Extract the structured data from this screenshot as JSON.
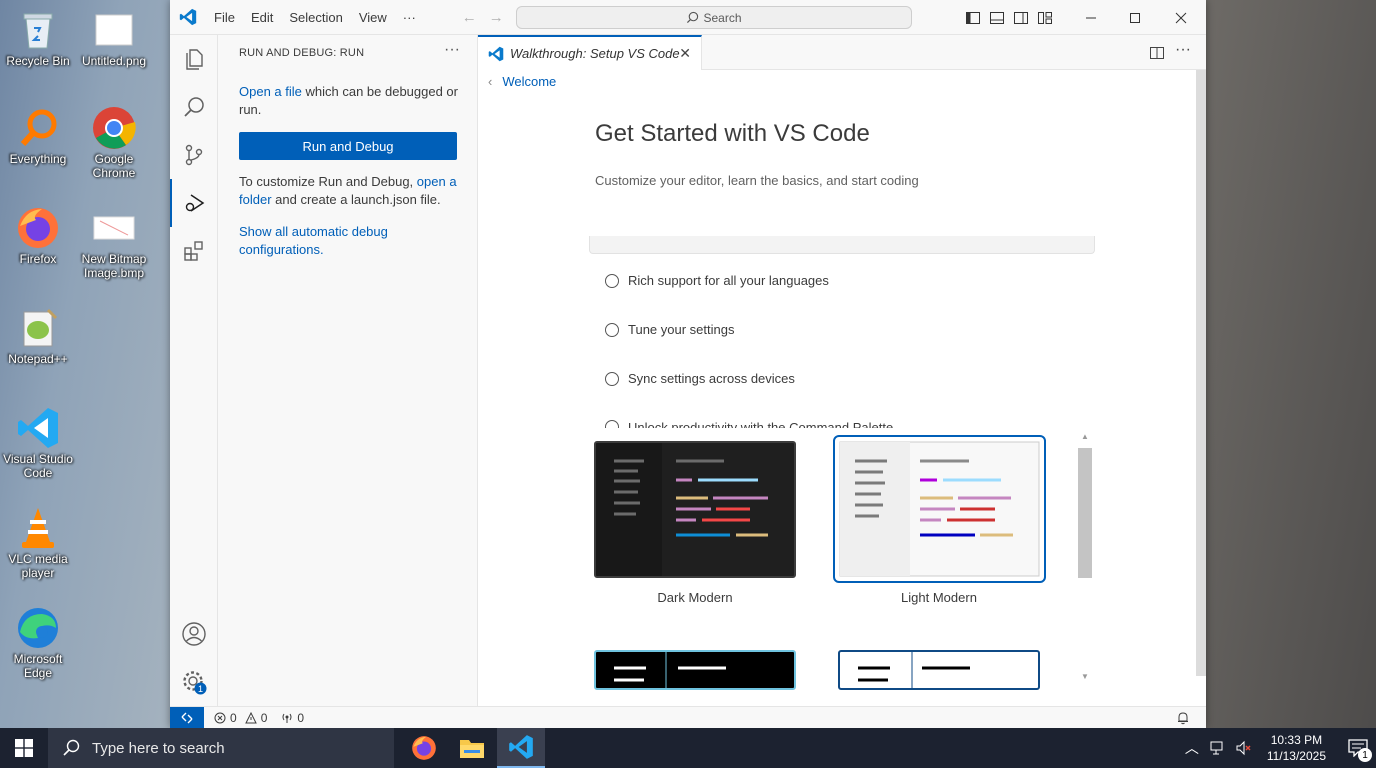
{
  "desktop": {
    "icons": [
      {
        "label": "Recycle Bin"
      },
      {
        "label": "Untitled.png"
      },
      {
        "label": "Everything"
      },
      {
        "label": "Google Chrome"
      },
      {
        "label": "Firefox"
      },
      {
        "label": "New Bitmap Image.bmp"
      },
      {
        "label": "Notepad++"
      },
      {
        "label": "Visual Studio Code"
      },
      {
        "label": "VLC media player"
      },
      {
        "label": "Microsoft Edge"
      }
    ]
  },
  "titlebar": {
    "menu": [
      "File",
      "Edit",
      "Selection",
      "View",
      "···"
    ],
    "search_label": "Search"
  },
  "sidebar": {
    "title": "RUN AND DEBUG: RUN",
    "more": "···",
    "open_file_link": "Open a file",
    "open_file_rest": " which can be debugged or run.",
    "run_button": "Run and Debug",
    "customize_pre": "To customize Run and Debug, ",
    "open_folder_link": "open a folder",
    "customize_post": " and create a launch.json file.",
    "show_all_link": "Show all automatic debug configurations",
    "show_all_end": "."
  },
  "tab": {
    "label": "Walkthrough: Setup VS Code",
    "close": "✕"
  },
  "walkthrough": {
    "breadcrumb": "Welcome",
    "title": "Get Started with VS Code",
    "subtitle": "Customize your editor, learn the basics, and start coding",
    "steps": [
      "Rich support for all your languages",
      "Tune your settings",
      "Sync settings across devices",
      "Unlock productivity with the Command Palette"
    ],
    "themes": [
      "Dark Modern",
      "Light Modern"
    ]
  },
  "statusbar": {
    "errors": "0",
    "warnings": "0",
    "ports": "0"
  },
  "taskbar": {
    "search_placeholder": "Type here to search",
    "time": "10:33 PM",
    "date": "11/13/2025",
    "notification_count": "1"
  },
  "colors": {
    "accent": "#005fb8",
    "taskbar": "#1c2230"
  }
}
